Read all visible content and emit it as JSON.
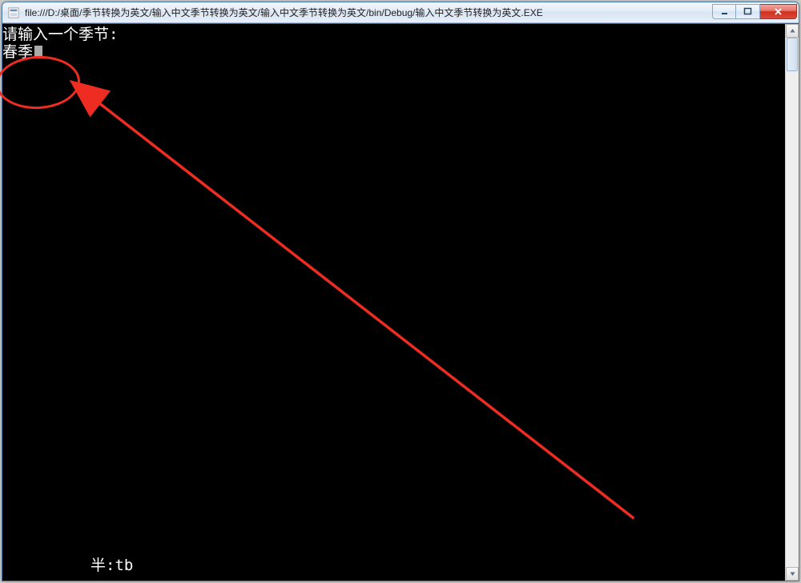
{
  "window": {
    "title": "file:///D:/桌面/季节转换为英文/输入中文季节转换为英文/输入中文季节转换为英文/bin/Debug/输入中文季节转换为英文.EXE"
  },
  "console": {
    "prompt_line": "请输入一个季节:",
    "input_line": "春季"
  },
  "ime": {
    "status": "半:tb"
  },
  "annotation": {
    "arrow_color": "#ee2c22",
    "ellipse_color": "#ee2c22"
  }
}
